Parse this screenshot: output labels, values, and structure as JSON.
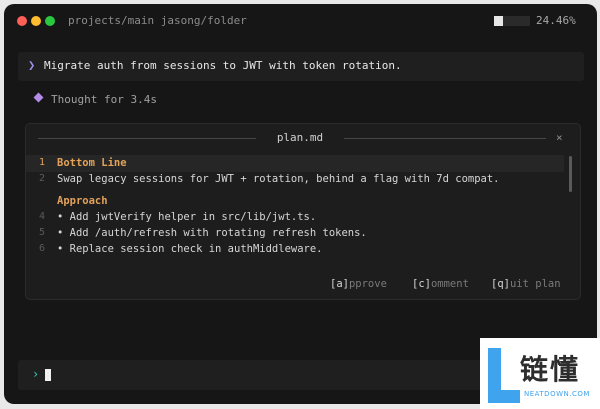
{
  "titlebar": {
    "path": "projects/main jasong/folder",
    "progress_percent": 24.46,
    "progress_label": "24.46%"
  },
  "prompt": {
    "chevron": "❯",
    "text": "Migrate auth from sessions to JWT with token rotation."
  },
  "thought": {
    "icon": "diamond-icon",
    "text": "Thought for 3.4s"
  },
  "plan": {
    "title": "plan.md",
    "close": "×",
    "lines": [
      {
        "n": "1",
        "text": "Bottom Line",
        "heading": true,
        "active": true
      },
      {
        "n": "2",
        "text": "Swap legacy sessions for JWT + rotation, behind a flag with 7d compat.",
        "heading": false
      },
      {
        "n": "",
        "text": "Approach",
        "heading": true
      },
      {
        "n": "4",
        "text": "• Add jwtVerify helper in src/lib/jwt.ts.",
        "heading": false
      },
      {
        "n": "5",
        "text": "• Add /auth/refresh with rotating refresh tokens.",
        "heading": false
      },
      {
        "n": "6",
        "text": "• Replace session check in authMiddleware.",
        "heading": false
      }
    ],
    "actions": [
      {
        "key": "[a]",
        "label": "pprove"
      },
      {
        "key": "[c]",
        "label": "omment"
      },
      {
        "key": "[q]",
        "label": "uit plan"
      }
    ]
  },
  "input": {
    "chevron": "›",
    "value": ""
  },
  "watermark": {
    "cn": "链懂",
    "en": "NEATDOWN.COM"
  },
  "colors": {
    "accent_purple": "#9d8ee8",
    "heading_orange": "#e2a25a",
    "input_teal": "#39c8b8",
    "watermark_blue": "#3fa3ee"
  }
}
